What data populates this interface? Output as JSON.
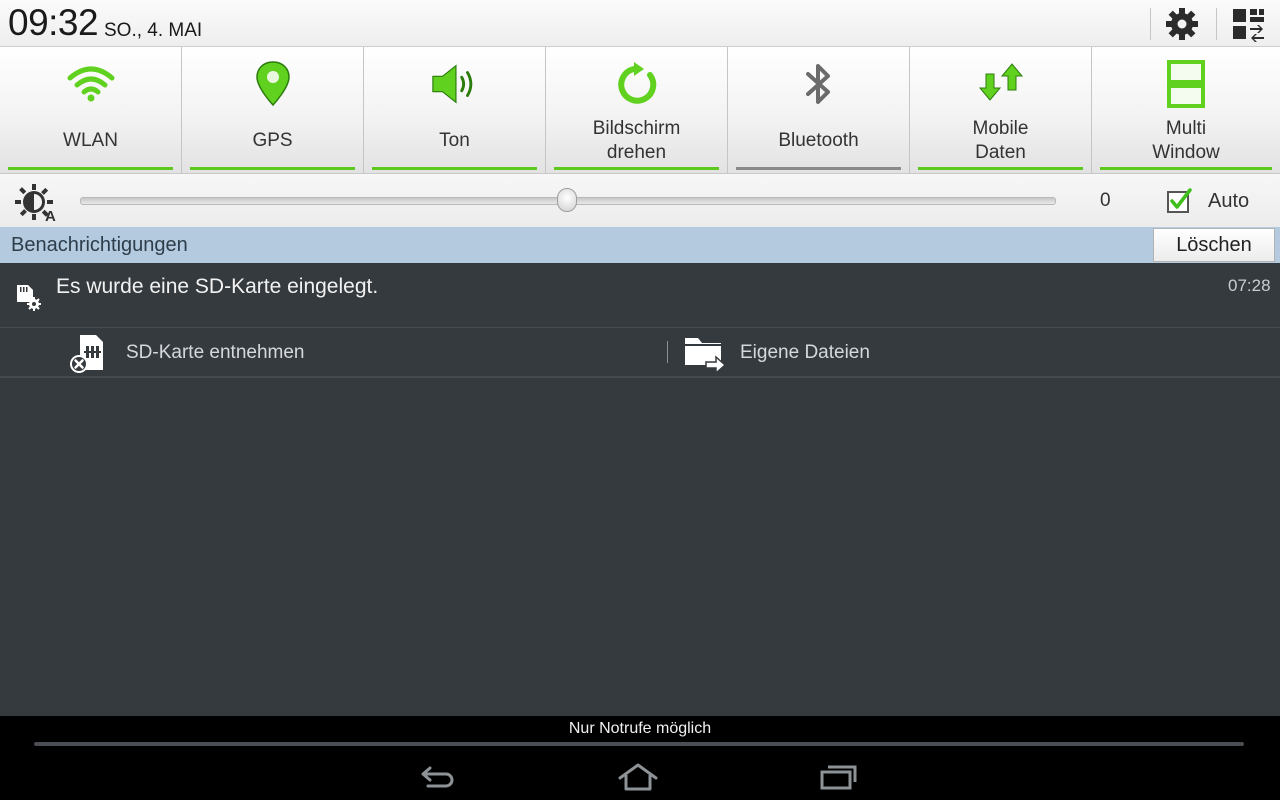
{
  "status": {
    "time": "09:32",
    "date": "SO., 4. MAI",
    "icons": [
      "gear-icon",
      "grid-edit-icon"
    ]
  },
  "toggles": [
    {
      "label": "WLAN",
      "icon": "wifi-icon",
      "active": true
    },
    {
      "label": "GPS",
      "icon": "location-pin-icon",
      "active": true
    },
    {
      "label": "Ton",
      "icon": "speaker-icon",
      "active": true
    },
    {
      "label": "Bildschirm\ndrehen",
      "icon": "rotate-icon",
      "active": true
    },
    {
      "label": "Bluetooth",
      "icon": "bluetooth-icon",
      "active": false
    },
    {
      "label": "Mobile\nDaten",
      "icon": "mobile-data-icon",
      "active": true
    },
    {
      "label": "Multi\nWindow",
      "icon": "multi-window-icon",
      "active": true
    }
  ],
  "brightness": {
    "value": "0",
    "level": 0.5,
    "auto_label": "Auto",
    "auto_checked": true
  },
  "notifications": {
    "title": "Benachrichtigungen",
    "clear_label": "Löschen",
    "items": [
      {
        "text": "Es wurde eine SD-Karte eingelegt.",
        "time": "07:28",
        "icon": "sd-card-settings-icon",
        "actions": [
          {
            "label": "SD-Karte entnehmen",
            "icon": "sd-card-remove-icon"
          },
          {
            "label": "Eigene Dateien",
            "icon": "folder-open-icon"
          }
        ]
      }
    ]
  },
  "bottom": {
    "emergency_text": "Nur Notrufe möglich",
    "nav": [
      "back-icon",
      "home-icon",
      "recent-apps-icon"
    ]
  },
  "colors": {
    "accent_green": "#5fc81e",
    "inactive_bar": "#8a8a8a",
    "panel_dark": "#353a3e",
    "header_blue": "#b3cadf"
  }
}
